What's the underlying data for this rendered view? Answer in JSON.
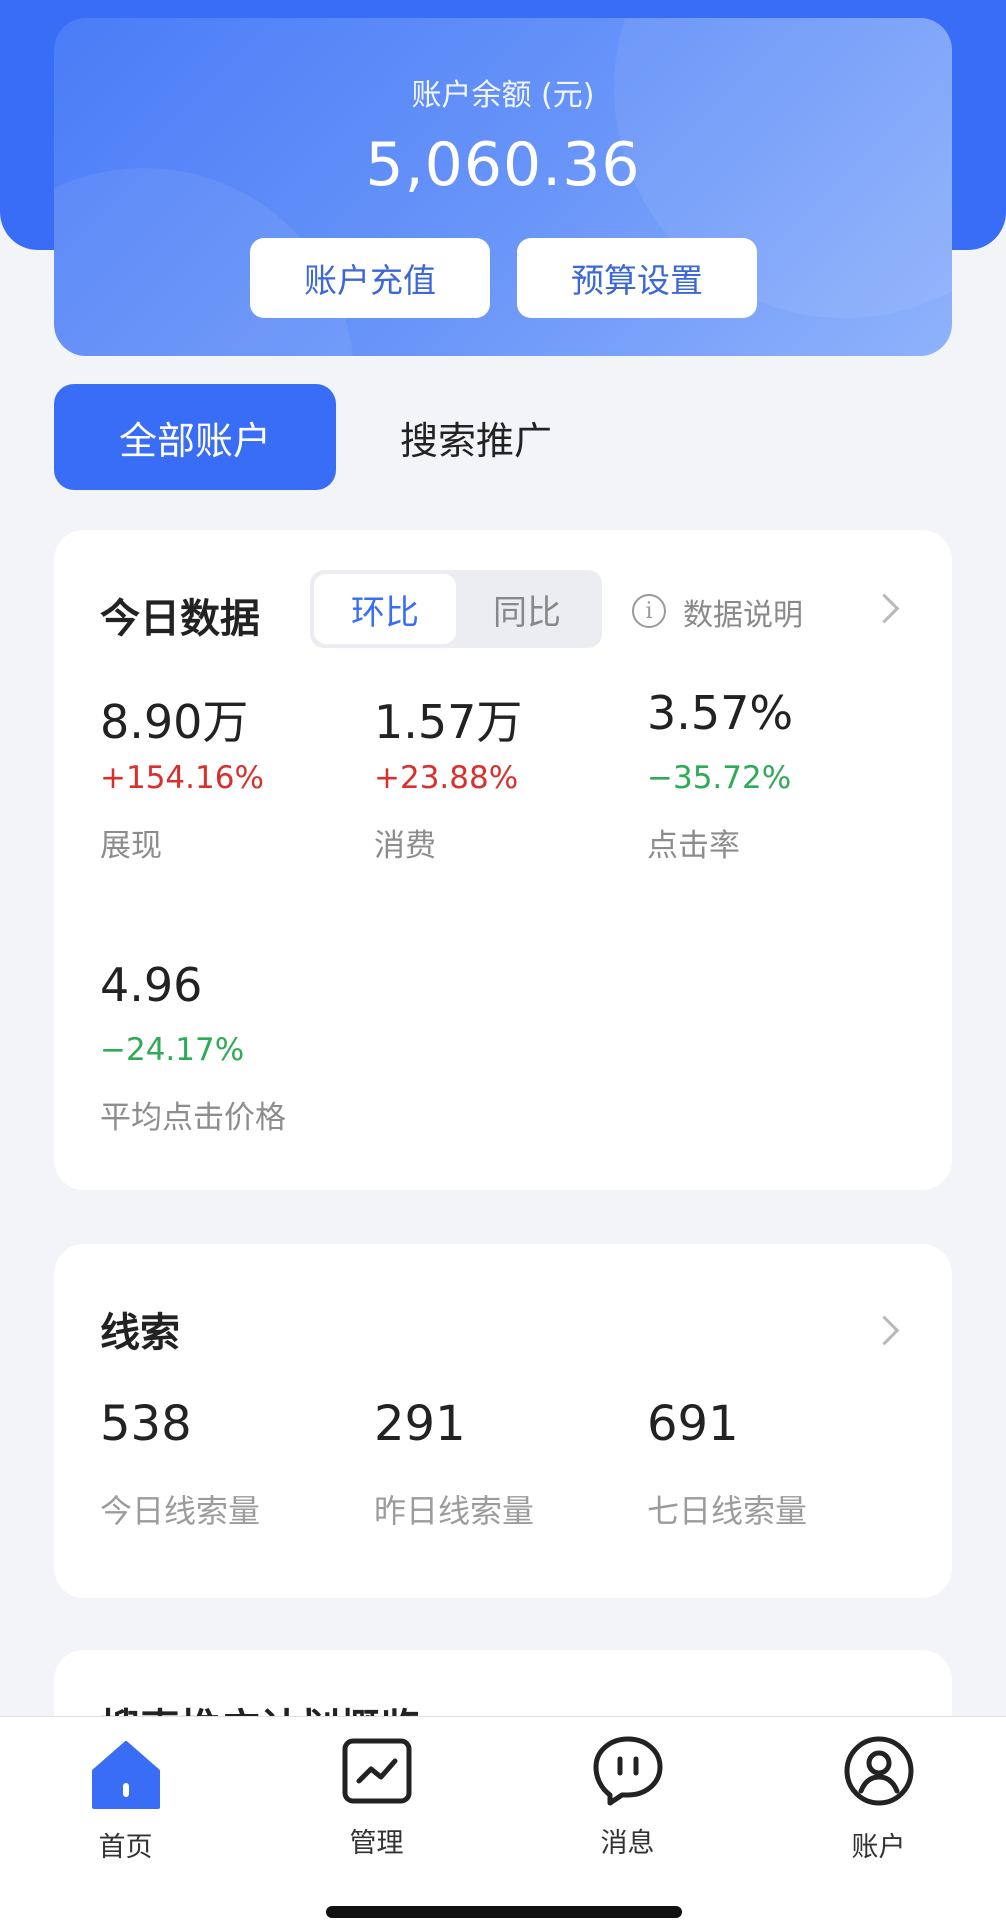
{
  "balance": {
    "title": "账户余额 (元)",
    "amount": "5,060.36",
    "recharge_label": "账户充值",
    "budget_label": "预算设置"
  },
  "account_tabs": {
    "active_label": "全部账户",
    "other_label": "搜索推广"
  },
  "today": {
    "title": "今日数据",
    "toggle_active": "环比",
    "toggle_inactive": "同比",
    "info_label": "数据说明",
    "metrics": [
      {
        "value": "8.90万",
        "change": "+154.16%",
        "label": "展现",
        "trend": "up"
      },
      {
        "value": "1.57万",
        "change": "+23.88%",
        "label": "消费",
        "trend": "up"
      },
      {
        "value": "3.57%",
        "change": "−35.72%",
        "label": "点击率",
        "trend": "down"
      },
      {
        "value": "4.96",
        "change": "−24.17%",
        "label": "平均点击价格",
        "trend": "down"
      }
    ]
  },
  "leads": {
    "title": "线索",
    "items": [
      {
        "value": "538",
        "label": "今日线索量"
      },
      {
        "value": "291",
        "label": "昨日线索量"
      },
      {
        "value": "691",
        "label": "七日线索量"
      }
    ]
  },
  "next_card": {
    "title": "搜索推广计划概览"
  },
  "tabbar": {
    "items": [
      {
        "label": "首页",
        "icon": "home-icon",
        "active": true
      },
      {
        "label": "管理",
        "icon": "chart-icon",
        "active": false
      },
      {
        "label": "消息",
        "icon": "message-icon",
        "active": false
      },
      {
        "label": "账户",
        "icon": "user-icon",
        "active": false
      }
    ]
  },
  "colors": {
    "primary": "#3a6df5",
    "up": "#d9302e",
    "down": "#2faa56"
  }
}
